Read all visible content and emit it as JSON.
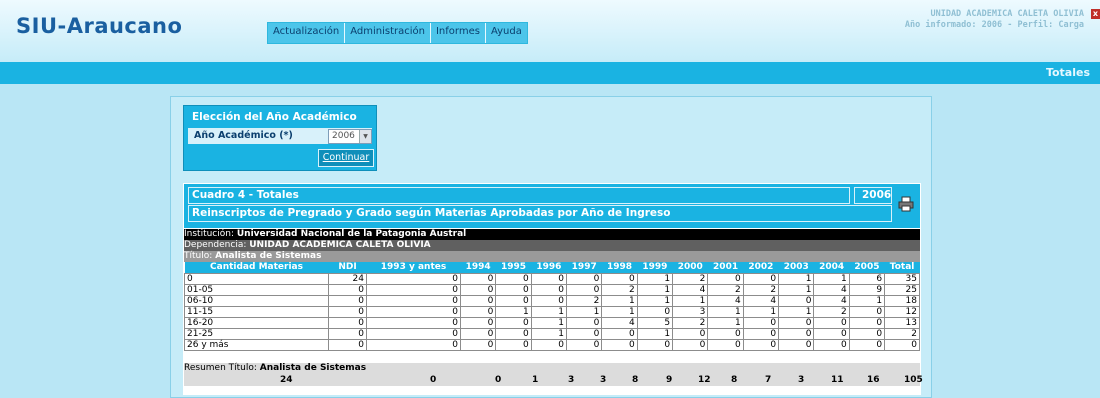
{
  "app": {
    "logo": "SIU-Araucano",
    "menu": [
      "Actualización",
      "Administración",
      "Informes",
      "Ayuda"
    ],
    "header_info_line1": "UNIDAD ACADEMICA CALETA OLIVIA",
    "header_info_line2": "Año informado: 2006 - Perfil: Carga",
    "close_glyph": "x",
    "section_title": "Totales"
  },
  "year_selector": {
    "title": "Elección del Año Académico",
    "label": "Año Académico (*)",
    "selected": "2006",
    "button": "Continuar"
  },
  "cuadro": {
    "title": "Cuadro 4 - Totales",
    "year": "2006",
    "subtitle": "Reinscriptos de Pregrado y Grado según Materias Aprobadas por Año de Ingreso",
    "institucion_label": "Institución: ",
    "institucion": "Universidad Nacional de la Patagonia Austral",
    "dependencia_label": "Dependencia: ",
    "dependencia": "UNIDAD ACADEMICA CALETA OLIVIA",
    "titulo_label": "Título: ",
    "titulo": "Analista de Sistemas",
    "resumen_label": "Resumen Título: ",
    "resumen": "Analista de Sistemas"
  },
  "table": {
    "columns": [
      "Cantidad Materias",
      "NDI",
      "1993 y antes",
      "1994",
      "1995",
      "1996",
      "1997",
      "1998",
      "1999",
      "2000",
      "2001",
      "2002",
      "2003",
      "2004",
      "2005",
      "Total"
    ],
    "rows": [
      [
        "0",
        "24",
        "0",
        "0",
        "0",
        "0",
        "0",
        "0",
        "1",
        "2",
        "0",
        "0",
        "1",
        "1",
        "6",
        "35"
      ],
      [
        "01-05",
        "0",
        "0",
        "0",
        "0",
        "0",
        "0",
        "2",
        "1",
        "4",
        "2",
        "2",
        "1",
        "4",
        "9",
        "25"
      ],
      [
        "06-10",
        "0",
        "0",
        "0",
        "0",
        "0",
        "2",
        "1",
        "1",
        "1",
        "4",
        "4",
        "0",
        "4",
        "1",
        "18"
      ],
      [
        "11-15",
        "0",
        "0",
        "0",
        "1",
        "1",
        "1",
        "1",
        "0",
        "3",
        "1",
        "1",
        "1",
        "2",
        "0",
        "12"
      ],
      [
        "16-20",
        "0",
        "0",
        "0",
        "0",
        "1",
        "0",
        "4",
        "5",
        "2",
        "1",
        "0",
        "0",
        "0",
        "0",
        "13"
      ],
      [
        "21-25",
        "0",
        "0",
        "0",
        "0",
        "1",
        "0",
        "0",
        "1",
        "0",
        "0",
        "0",
        "0",
        "0",
        "0",
        "2"
      ],
      [
        "26 y más",
        "0",
        "0",
        "0",
        "0",
        "0",
        "0",
        "0",
        "0",
        "0",
        "0",
        "0",
        "0",
        "0",
        "0",
        "0"
      ]
    ],
    "summary": [
      "24",
      "0",
      "0",
      "1",
      "3",
      "3",
      "8",
      "9",
      "12",
      "8",
      "7",
      "3",
      "11",
      "16",
      "105"
    ]
  }
}
